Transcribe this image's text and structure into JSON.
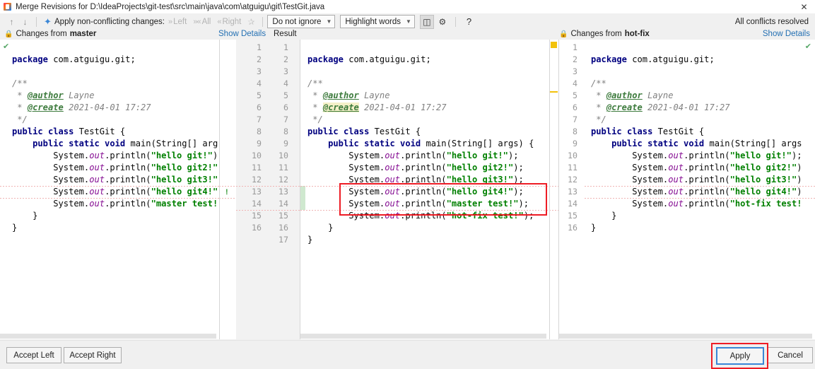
{
  "window": {
    "title": "Merge Revisions for D:\\IdeaProjects\\git-test\\src\\main\\java\\com\\atguigu\\git\\TestGit.java",
    "app_icon": "intellij-idea-icon",
    "close_label": "✕"
  },
  "toolbar": {
    "prev_icon": "arrow-up-icon",
    "next_icon": "arrow-down-icon",
    "resolve_icon": "apply-non-conflicting-icon",
    "apply_nonconflicting_label": "Apply non-conflicting changes:",
    "left_label": "Left",
    "all_label": "All",
    "right_label": "Right",
    "magic_icon": "magic-wand-icon",
    "ignore_policy": "Do not ignore",
    "highlight_policy": "Highlight words",
    "collapse_icon": "collapse-unchanged-icon",
    "settings_icon": "gear-icon",
    "help_icon": "?",
    "status_right": "All conflicts resolved"
  },
  "subheader": {
    "lock_icon": "lock-icon",
    "left_prefix": "Changes from ",
    "left_branch": "master",
    "left_show_details": "Show Details",
    "result_label": "Result",
    "right_prefix": "Changes from ",
    "right_branch": "hot-fix",
    "right_show_details": "Show Details"
  },
  "editors": {
    "left": {
      "accept_check_icon": "accepted-check-icon",
      "lines": [
        "package com.atguigu.git;",
        "",
        "/**",
        " * @author Layne",
        " * @create 2021-04-01 17:27",
        " */",
        "public class TestGit {",
        "    public static void main(String[] arg",
        "        System.out.println(\"hello git!\")",
        "        System.out.println(\"hello git2!\"",
        "        System.out.println(\"hello git3!\"",
        "        System.out.println(\"hello git4!\"",
        "        System.out.println(\"master test!",
        "    }",
        "}"
      ]
    },
    "center": {
      "line_numbers_a": [
        "1",
        "2",
        "3",
        "4",
        "5",
        "6",
        "7",
        "8",
        "9",
        "10",
        "11",
        "12",
        "13",
        "14",
        "15",
        "16",
        ""
      ],
      "line_numbers_b": [
        "1",
        "2",
        "3",
        "4",
        "5",
        "6",
        "7",
        "8",
        "9",
        "10",
        "11",
        "12",
        "13",
        "14",
        "15",
        "16",
        "17"
      ],
      "lines": [
        "package com.atguigu.git;",
        "",
        "/**",
        " * @author Layne",
        " * @create 2021-04-01 17:27",
        " */",
        "public class TestGit {",
        "    public static void main(String[] args) {",
        "        System.out.println(\"hello git!\");",
        "        System.out.println(\"hello git2!\");",
        "        System.out.println(\"hello git3!\");",
        "        System.out.println(\"hello git4!\");",
        "        System.out.println(\"master test!\");",
        "        System.out.println(\"hot-fix test!\");",
        "    }",
        "}"
      ],
      "marker_color": "#f2c20c",
      "highlight_box_color": "#ee1c25"
    },
    "right": {
      "accept_check_icon": "accepted-check-icon",
      "line_numbers": [
        "1",
        "2",
        "3",
        "4",
        "5",
        "6",
        "7",
        "8",
        "9",
        "10",
        "11",
        "12",
        "13",
        "14",
        "15",
        "16"
      ],
      "lines": [
        "package com.atguigu.git;",
        "",
        "/**",
        " * @author Layne",
        " * @create 2021-04-01 17:27",
        " */",
        "public class TestGit {",
        "    public static void main(String[] args",
        "        System.out.println(\"hello git!\");",
        "        System.out.println(\"hello git2!\")",
        "        System.out.println(\"hello git3!\")",
        "        System.out.println(\"hello git4!\")",
        "        System.out.println(\"hot-fix test!",
        "    }",
        "}"
      ]
    }
  },
  "footer": {
    "accept_left": "Accept Left",
    "accept_right": "Accept Right",
    "apply": "Apply",
    "cancel": "Cancel",
    "apply_focus_color": "#3a86d6",
    "annotation_color": "#ee1c25"
  }
}
